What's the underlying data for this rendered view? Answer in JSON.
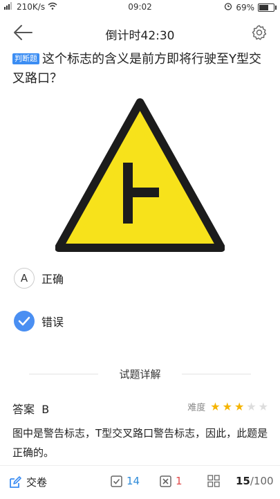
{
  "statusbar": {
    "speed": "210K/s",
    "time": "09:02",
    "battery": "69%"
  },
  "header": {
    "title": "倒计时42:30"
  },
  "question": {
    "tag": "判断题",
    "text": "这个标志的含义是前方即将行驶至Y型交叉路口？"
  },
  "options": [
    {
      "key": "A",
      "label": "正确",
      "selected": false
    },
    {
      "key": "B",
      "label": "错误",
      "selected": true
    }
  ],
  "analysis": {
    "title": "试题详解",
    "answer_label": "答案",
    "answer_value": "B",
    "difficulty_label": "难度",
    "difficulty_stars": 3,
    "difficulty_max": 5,
    "explanation": "图中是警告标志，T型交叉路口警告标志，因此，此题是正确的。"
  },
  "bottombar": {
    "submit_label": "交卷",
    "correct_count": "14",
    "wrong_count": "1",
    "current": "15",
    "total": "/100"
  },
  "colors": {
    "accent": "#3b8df3",
    "correct": "#2f8bd8",
    "wrong": "#e04a4a",
    "star": "#f5b400",
    "sign_yellow": "#f7e21b"
  }
}
